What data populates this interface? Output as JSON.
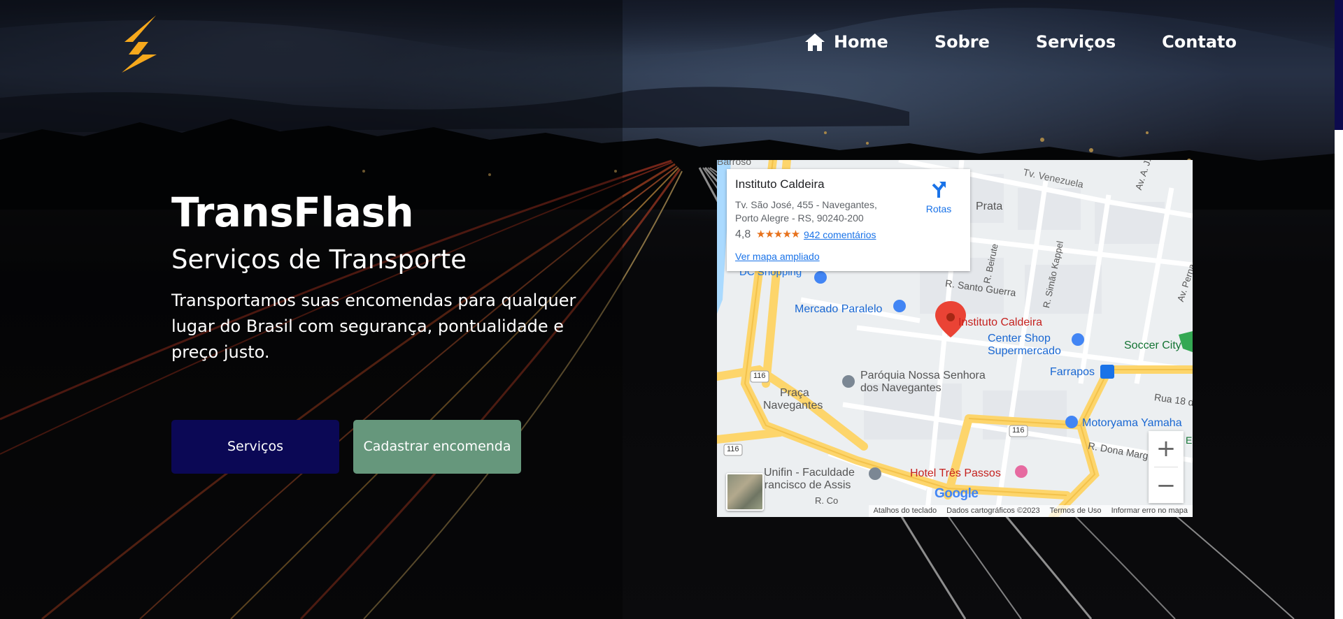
{
  "brand": {
    "logo_icon": "lightning-bolt-icon",
    "accent": "#f6a81c"
  },
  "nav": {
    "home_icon": "home-icon",
    "items": [
      {
        "label": "Home"
      },
      {
        "label": "Sobre"
      },
      {
        "label": "Serviços"
      },
      {
        "label": "Contato"
      }
    ]
  },
  "hero": {
    "title": "TransFlash",
    "subtitle": "Serviços de Transporte",
    "description": "Transportamos suas encomendas para qualquer lugar do Brasil com segurança, pontualidade e preço justo.",
    "buttons": {
      "servicos": "Serviços",
      "cadastrar": "Cadastrar encomenda"
    },
    "colors": {
      "primary_button": "#0b0855",
      "secondary_button": "#66977c"
    }
  },
  "map": {
    "place": {
      "name": "Instituto Caldeira",
      "address": "Tv. São José, 455 - Navegantes, Porto Alegre - RS, 90240-200",
      "rating": "4,8",
      "stars": "★★★★★",
      "reviews": "942 comentários",
      "larger_map": "Ver mapa ampliado",
      "directions": "Rotas"
    },
    "labels": {
      "barroso": "Barroso",
      "venezuela": "Tv. Venezuela",
      "prata": "Prata",
      "av_aj_renner": "Av. A. J. Renner",
      "av_pernambuco": "Av. Perna",
      "beirute": "R. Beirute",
      "simao_kappel": "R. Simão Kappel",
      "santo_guerra": "R. Santo Guerra",
      "dc_shopping": "DC Shopping",
      "mercado_paralelo": "Mercado Paralelo",
      "instituto_caldeira": "Instituto Caldeira",
      "center_shop": "Center Shop",
      "supermercado": "Supermercado",
      "soccer_city": "Soccer City",
      "farrapos": "Farrapos",
      "paroquia_1": "Paróquia Nossa Senhora",
      "paroquia_2": "dos Navegantes",
      "praca_1": "Praça",
      "praca_2": "Navegantes",
      "rua_18": "Rua 18 d",
      "motoryama": "Motoryama Yamaha",
      "dona_marg": "R. Dona Marg",
      "hotel": "Hotel Três Passos",
      "unifin_1": "Unifin - Faculdade",
      "unifin_2": "Francisco de Assis",
      "r_co": "R. Co",
      "route_116": "116",
      "google": "Google",
      "e_tail": "E"
    },
    "zoom_in": "+",
    "zoom_out": "−",
    "footer": {
      "shortcuts": "Atalhos do teclado",
      "data": "Dados cartográficos ©2023",
      "terms": "Termos de Uso",
      "report": "Informar erro no mapa"
    },
    "colors": {
      "highway": "#fdd56b",
      "water": "#aadaff",
      "pin": "#ea4335",
      "link": "#1a73e8"
    }
  }
}
